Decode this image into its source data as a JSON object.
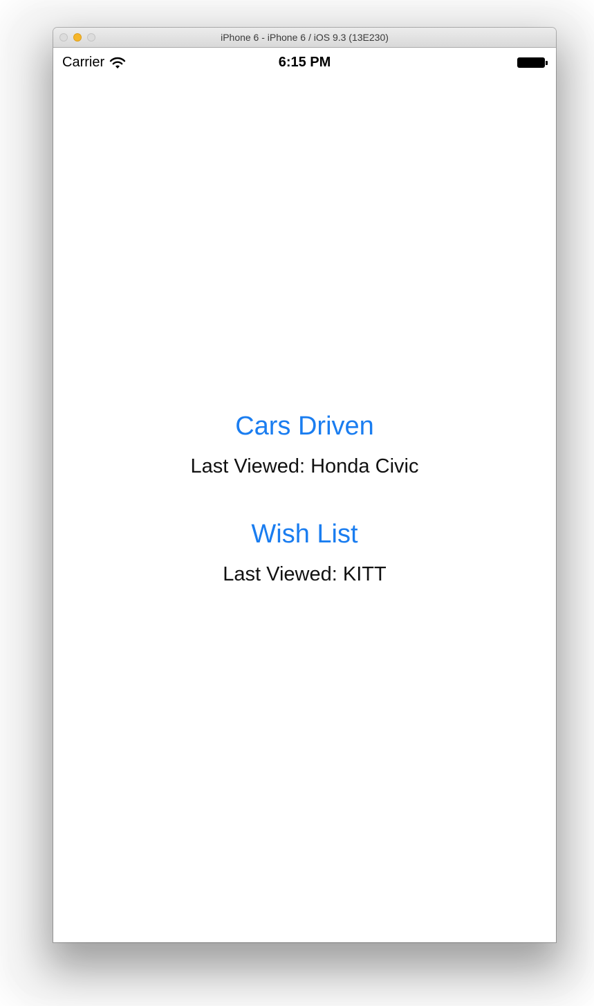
{
  "window": {
    "title": "iPhone 6 - iPhone 6 / iOS 9.3 (13E230)"
  },
  "statusbar": {
    "carrier": "Carrier",
    "time": "6:15 PM",
    "wifi_icon": "wifi-icon",
    "battery_icon": "battery-icon"
  },
  "content": {
    "sections": [
      {
        "title": "Cars Driven",
        "subtitle": "Last Viewed: Honda Civic"
      },
      {
        "title": "Wish List",
        "subtitle": "Last Viewed: KITT"
      }
    ]
  },
  "colors": {
    "link_blue": "#1a7df0",
    "text": "#111111",
    "minimize_light": "#f5b62b"
  }
}
